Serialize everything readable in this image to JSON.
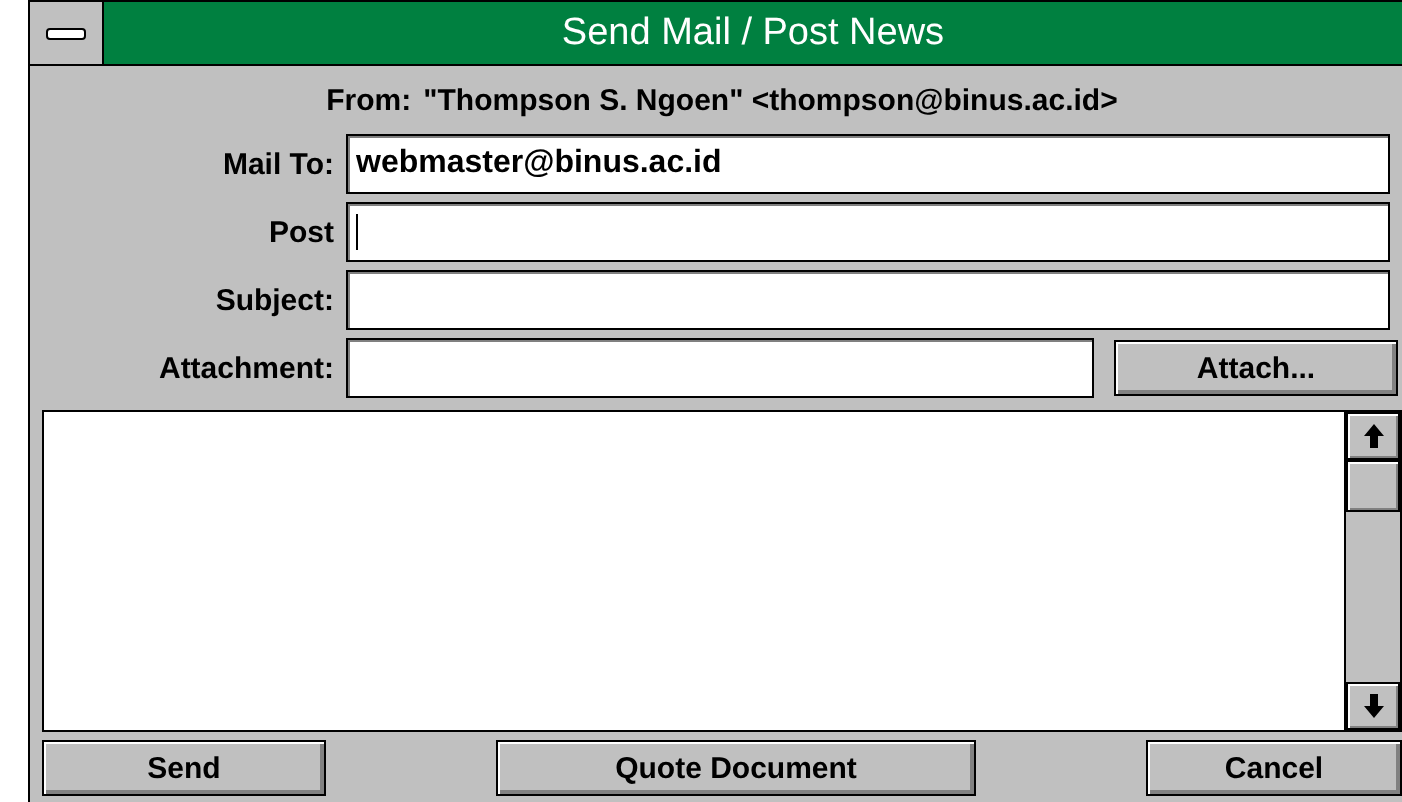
{
  "window": {
    "title": "Send Mail / Post News"
  },
  "from": {
    "label": "From:",
    "value": "\"Thompson S. Ngoen\" <thompson@binus.ac.id>"
  },
  "fields": [
    {
      "label": "Mail To:",
      "value": "webmaster@binus.ac.id",
      "focused": false
    },
    {
      "label": "Post",
      "focused": true
    },
    {
      "label": "Subject:",
      "focused": false
    }
  ],
  "attachment": {
    "label": "Attachment:",
    "button": "Attach..."
  },
  "buttons": [
    "Send",
    "Quote Document",
    "Cancel"
  ]
}
